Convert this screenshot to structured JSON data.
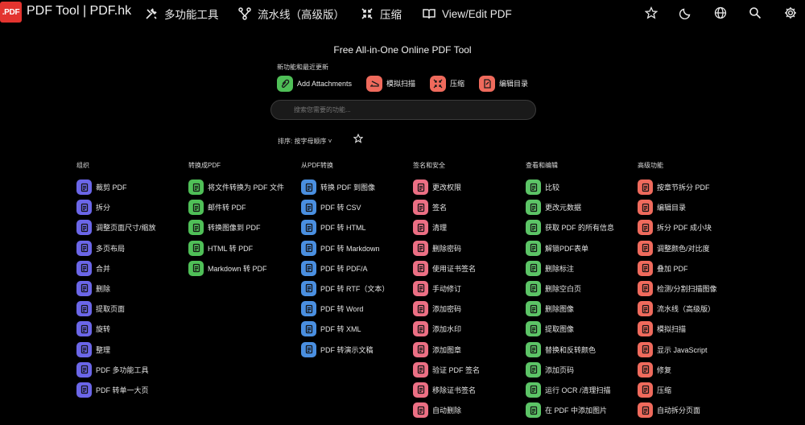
{
  "header": {
    "logo_text": ".PDF",
    "brand": "PDF Tool | PDF.hk",
    "nav": [
      {
        "label": "多功能工具",
        "icon": "tools-icon"
      },
      {
        "label": "流水线（高级版）",
        "icon": "pipeline-icon"
      },
      {
        "label": "压缩",
        "icon": "compress-icon"
      },
      {
        "label": "View/Edit PDF",
        "icon": "book-icon"
      }
    ],
    "right_icons": [
      "star-icon",
      "moon-icon",
      "globe-icon",
      "search-icon",
      "gear-icon"
    ]
  },
  "hero": {
    "title": "Free All-in-One Online PDF Tool",
    "recent_label": "新功能和最近更新",
    "recent": [
      {
        "label": "Add Attachments",
        "color": "#4fbf57",
        "icon": "paperclip-icon"
      },
      {
        "label": "模拟扫描",
        "color": "#ef6a5c",
        "icon": "scanner-icon"
      },
      {
        "label": "压缩",
        "color": "#ef6a5c",
        "icon": "compress-icon"
      },
      {
        "label": "编辑目录",
        "color": "#ef6a5c",
        "icon": "edit-toc-icon"
      }
    ],
    "search_placeholder": "搜索您需要的功能...",
    "sort_label": "排序: 按字母顺序 ˅"
  },
  "categories": [
    {
      "title": "组织",
      "color": "#6b66e8",
      "tools": [
        "裁剪 PDF",
        "拆分",
        "调整页面尺寸/缩放",
        "多页布局",
        "合并",
        "删除",
        "提取页面",
        "旋转",
        "整理",
        "PDF 多功能工具",
        "PDF 转单一大页"
      ]
    },
    {
      "title": "转换成PDF",
      "color": "#4fbf57",
      "tools": [
        "将文件转换为 PDF 文件",
        "邮件转 PDF",
        "转换图像到 PDF",
        "HTML 转 PDF",
        "Markdown 转 PDF"
      ]
    },
    {
      "title": "从PDF转换",
      "color": "#4a8fe0",
      "tools": [
        "转换 PDF 到图像",
        "PDF 转 CSV",
        "PDF 转 HTML",
        "PDF 转 Markdown",
        "PDF 转 PDF/A",
        "PDF 转 RTF（文本）",
        "PDF 转 Word",
        "PDF 转 XML",
        "PDF 转演示文稿"
      ]
    },
    {
      "title": "签名和安全",
      "color": "#ec6f84",
      "tools": [
        "更改权限",
        "签名",
        "清理",
        "删除密码",
        "使用证书签名",
        "手动修订",
        "添加密码",
        "添加水印",
        "添加图章",
        "验证 PDF 签名",
        "移除证书签名",
        "自动删除"
      ]
    },
    {
      "title": "查看和编辑",
      "color": "#5cc466",
      "tools": [
        "比较",
        "更改元数据",
        "获取 PDF 的所有信息",
        "解锁PDF表单",
        "删除标注",
        "删除空白页",
        "删除图像",
        "提取图像",
        "替换和反转颜色",
        "添加页码",
        "运行 OCR /清理扫描",
        "在 PDF 中添加图片"
      ]
    },
    {
      "title": "高级功能",
      "color": "#ef6a5c",
      "tools": [
        "按章节拆分 PDF",
        "编辑目录",
        "拆分 PDF 成小块",
        "调整颜色/对比度",
        "叠加 PDF",
        "检测/分割扫描图像",
        "流水线（高级版）",
        "模拟扫描",
        "显示 JavaScript",
        "修复",
        "压缩",
        "自动拆分页面"
      ]
    }
  ]
}
